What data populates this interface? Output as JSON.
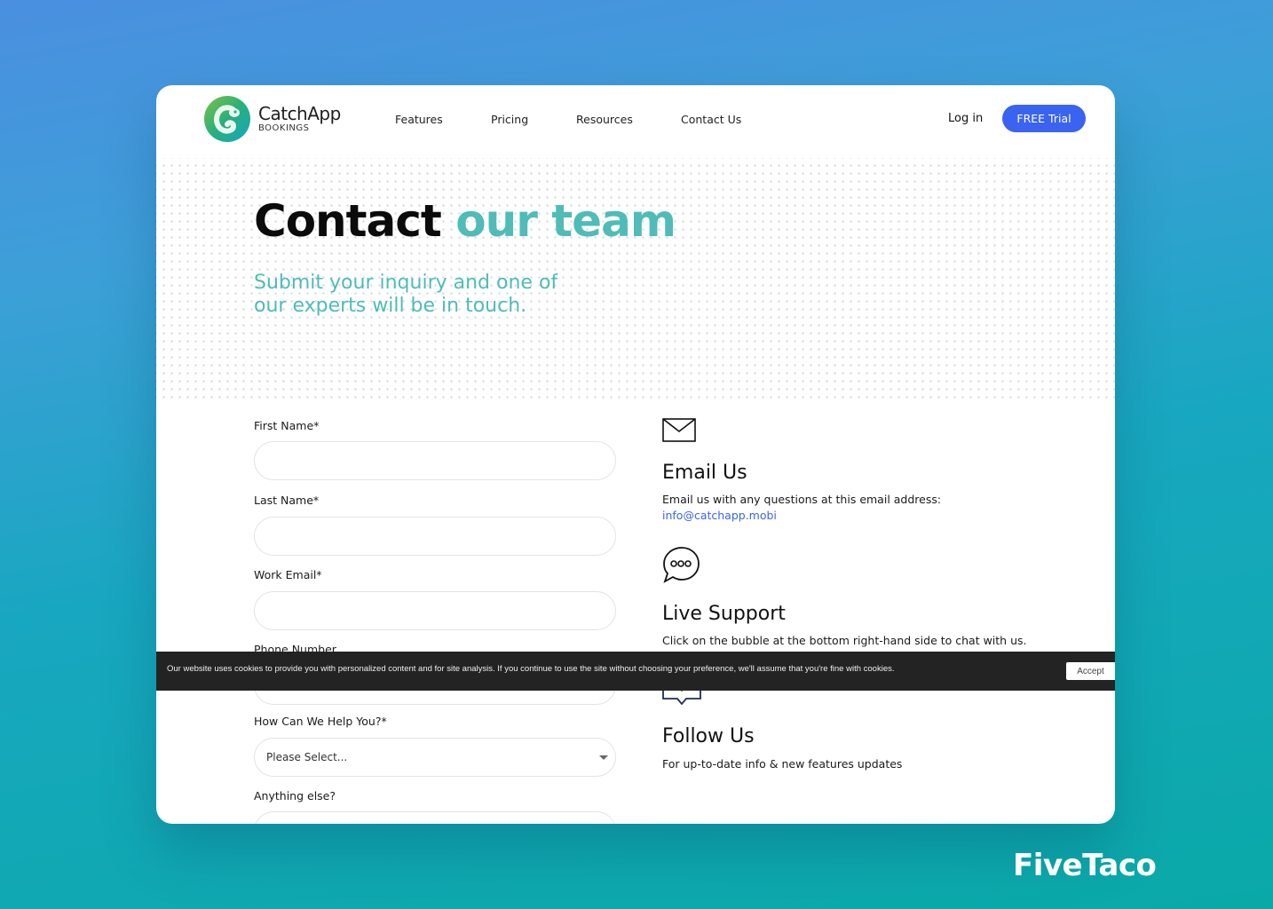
{
  "nav": {
    "logo": {
      "name": "CatchApp",
      "subtitle": "BOOKINGS"
    },
    "links": [
      {
        "label": "Features"
      },
      {
        "label": "Pricing"
      },
      {
        "label": "Resources"
      },
      {
        "label": "Contact Us"
      }
    ],
    "login_label": "Log in",
    "trial_label": "FREE Trial"
  },
  "hero": {
    "title_main": "Contact",
    "title_accent": "our team",
    "subtitle": "Submit your inquiry and one of our experts will be in touch."
  },
  "form": {
    "fields": [
      {
        "label": "First Name*",
        "value": ""
      },
      {
        "label": "Last Name*",
        "value": ""
      },
      {
        "label": "Work Email*",
        "value": ""
      },
      {
        "label": "Phone Number",
        "value": ""
      },
      {
        "label": "How Can We Help You?*",
        "selected": "Please Select..."
      },
      {
        "label": "Anything else?",
        "value": ""
      }
    ]
  },
  "info": {
    "email": {
      "icon": "envelope-icon",
      "title": "Email Us",
      "text": "Email us with any questions at this email address:",
      "link": "info@catchapp.mobi"
    },
    "support": {
      "icon": "chat-bubble-icon",
      "title": "Live Support",
      "text": "Click on the bubble at the bottom right-hand side to chat with us."
    },
    "follow": {
      "icon": "heart-message-icon",
      "title": "Follow Us",
      "text": "For up-to-date info & new features updates"
    }
  },
  "cookie": {
    "text": "Our website uses cookies to provide you with personalized content and for site analysis. If you continue to use the site without choosing your preference, we'll assume that you're fine with cookies.",
    "accept_label": "Accept"
  },
  "colors": {
    "accent_teal": "#4fbcb8",
    "primary_blue": "#3a63f0",
    "cookie_bg": "#232323"
  },
  "watermark": "FiveTaco"
}
